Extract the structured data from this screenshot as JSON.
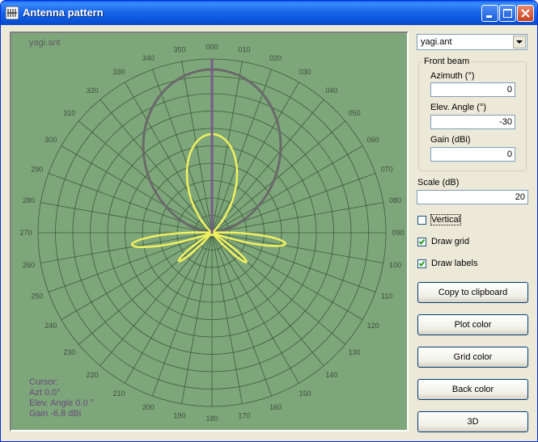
{
  "window": {
    "title": "Antenna pattern"
  },
  "plot": {
    "file_label": "yagi.ant",
    "background_color": "#7DA67A",
    "grid_color": "#3F5A3C",
    "plot_color": "#F0F060",
    "max_color": "#6A6A6A",
    "azimuth_labels": [
      "000",
      "010",
      "020",
      "030",
      "040",
      "050",
      "060",
      "070",
      "080",
      "090",
      "100",
      "110",
      "120",
      "130",
      "140",
      "150",
      "160",
      "170",
      "180",
      "190",
      "200",
      "210",
      "220",
      "230",
      "240",
      "250",
      "260",
      "270",
      "280",
      "290",
      "300",
      "310",
      "320",
      "330",
      "340",
      "350"
    ],
    "cursor": {
      "title": "Cursor:",
      "azimuth": "Azt 0.0°",
      "elevation": "Elev. Angle 0.0 °",
      "gain": "Gain -6.8 dBi"
    }
  },
  "file_select": {
    "value": "yagi.ant"
  },
  "front_beam": {
    "legend": "Front beam",
    "azimuth_label": "Azimuth (°)",
    "azimuth_value": "0",
    "elev_label": "Elev. Angle (°)",
    "elev_value": "-30",
    "gain_label": "Gain (dBi)",
    "gain_value": "0"
  },
  "scale": {
    "label": "Scale (dB)",
    "value": "20"
  },
  "options": {
    "vertical": {
      "label": "Vertical",
      "checked": false
    },
    "draw_grid": {
      "label": "Draw grid",
      "checked": true
    },
    "draw_labels": {
      "label": "Draw labels",
      "checked": true
    }
  },
  "buttons": {
    "copy": "Copy to clipboard",
    "plot_color": "Plot color",
    "grid_color": "Grid color",
    "back_color": "Back color",
    "three_d": "3D"
  }
}
